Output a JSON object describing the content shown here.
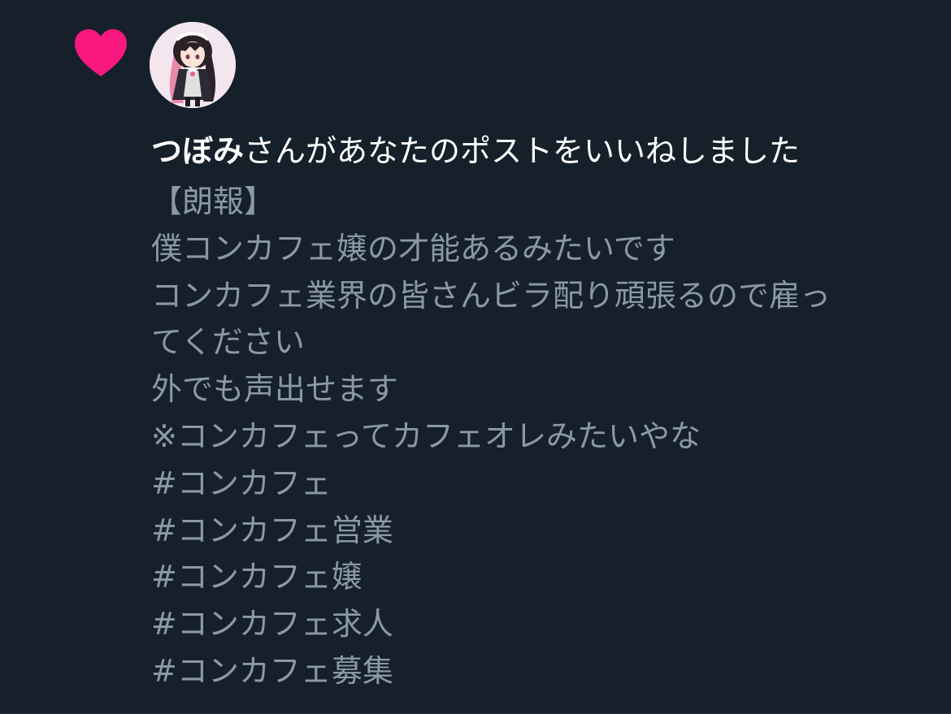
{
  "notification": {
    "type_icon": "heart-icon",
    "heart_color": "#f91880",
    "avatar": "user-avatar",
    "user_name": "つぼみ",
    "action_text": "さんがあなたのポストをいいねしました"
  },
  "post": {
    "lines": [
      "【朗報】",
      "僕コンカフェ嬢の才能あるみたいです",
      "コンカフェ業界の皆さんビラ配り頑張るので雇っ",
      "てください",
      "外でも声出せます",
      "※コンカフェってカフェオレみたいやな"
    ],
    "hashtags": [
      "#コンカフェ",
      "#コンカフェ営業",
      "#コンカフェ嬢",
      "#コンカフェ求人",
      "#コンカフェ募集"
    ]
  },
  "colors": {
    "background": "#15202b",
    "text_primary": "#ffffff",
    "text_secondary": "#8b98a5"
  }
}
